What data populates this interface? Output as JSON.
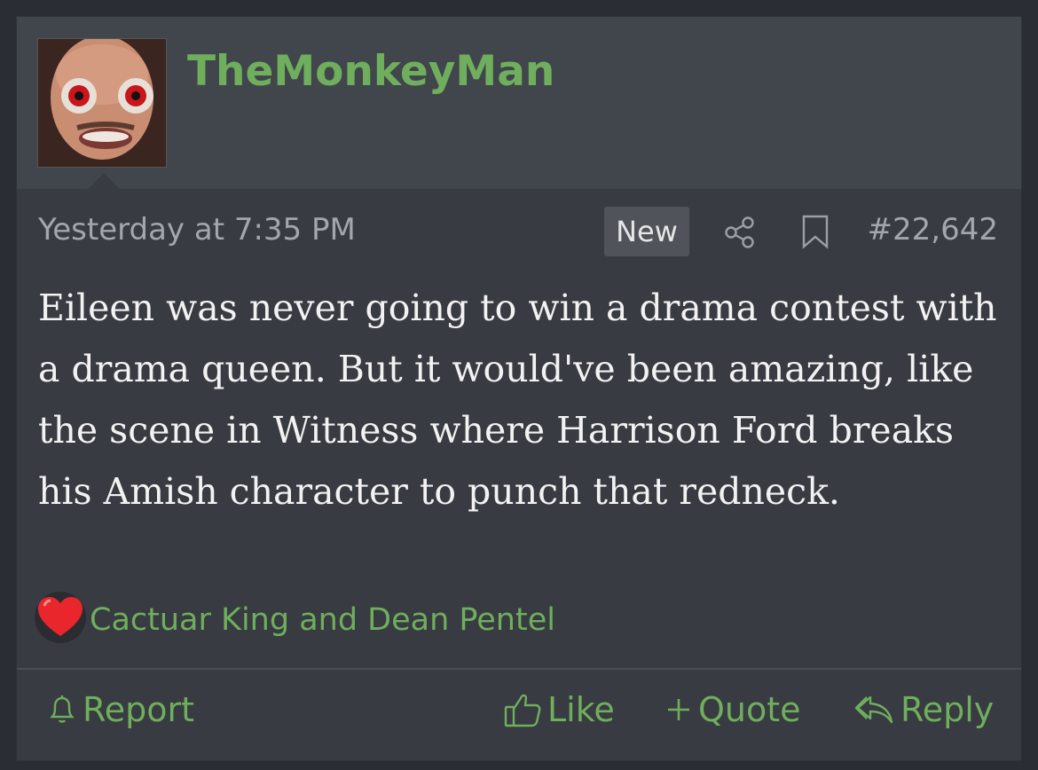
{
  "post": {
    "username": "TheMonkeyMan",
    "timestamp": "Yesterday at 7:35 PM",
    "new_badge": "New",
    "post_number": "#22,642",
    "body": "Eileen was never going to win a drama contest with a drama queen. But it would've been amazing, like the scene in Witness where Harrison Ford breaks his Amish character to punch that redneck.",
    "reactions": {
      "icon": "heart-icon",
      "users": "Cactuar King and Dean Pentel"
    },
    "actions": {
      "report": "Report",
      "like": "Like",
      "quote": "Quote",
      "reply": "Reply"
    }
  },
  "colors": {
    "accent_green": "#6fae5c",
    "panel": "#383b42",
    "header": "#41454c"
  }
}
